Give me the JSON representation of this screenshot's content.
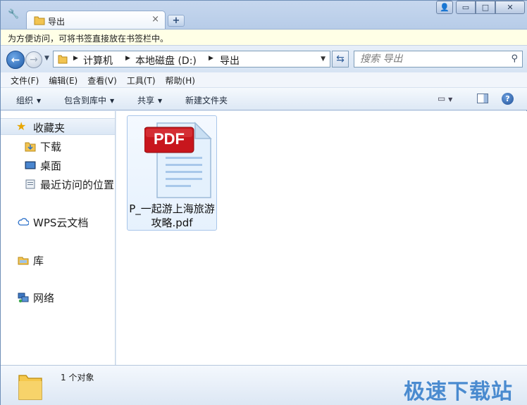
{
  "tab": {
    "title": "导出",
    "close_glyph": "×",
    "new_glyph": "+"
  },
  "window": {
    "user_glyph": "👤",
    "min_glyph": "▭",
    "max_glyph": "□",
    "close_glyph": "✕"
  },
  "infobar": {
    "text": "为方便访问，可将书签直接放在书签栏中。"
  },
  "address": {
    "crumbs": [
      "计算机",
      "本地磁盘 (D:)",
      "导出"
    ],
    "search_placeholder": "搜索 导出"
  },
  "menu": [
    "文件(F)",
    "编辑(E)",
    "查看(V)",
    "工具(T)",
    "帮助(H)"
  ],
  "commands": {
    "organize": "组织",
    "include": "包含到库中",
    "share": "共享",
    "new_folder": "新建文件夹"
  },
  "nav": {
    "favorites": "收藏夹",
    "downloads": "下载",
    "desktop": "桌面",
    "recent": "最近访问的位置",
    "wps": "WPS云文档",
    "libraries": "库",
    "network": "网络"
  },
  "file": {
    "badge": "PDF",
    "name": "P_一起游上海旅游攻略.pdf"
  },
  "status": {
    "count": "1 个对象"
  },
  "watermark": "极速下载站",
  "colors": {
    "accent": "#2f7ac9",
    "pdf_red": "#c8161d"
  }
}
